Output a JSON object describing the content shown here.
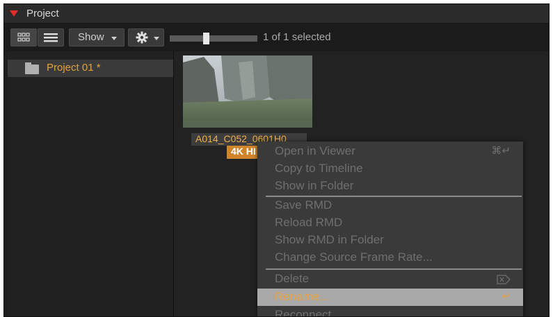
{
  "window": {
    "title": "Project"
  },
  "toolbar": {
    "grid_view_icon": "grid-view-icon",
    "list_view_icon": "list-view-icon",
    "show_label": "Show",
    "gear_icon": "gear-icon",
    "selection_status": "1 of 1 selected"
  },
  "sidebar": {
    "items": [
      {
        "label": "Project 01 *",
        "icon": "folder-icon"
      }
    ]
  },
  "clip": {
    "name": "A014_C052_0601H0",
    "resolution_badge": "4K HI"
  },
  "context_menu": {
    "items": [
      {
        "label": "Open in Viewer",
        "shortcut": "⌘↵"
      },
      {
        "label": "Copy to Timeline"
      },
      {
        "label": "Show in Folder"
      },
      {
        "label": "Save RMD"
      },
      {
        "label": "Reload RMD"
      },
      {
        "label": "Show RMD in Folder"
      },
      {
        "label": "Change Source Frame Rate..."
      },
      {
        "label": "Delete",
        "shortcut_icon": "delete-key-icon"
      },
      {
        "label": "Rename...",
        "shortcut": "↵",
        "highlighted": true
      },
      {
        "label": "Reconnect..."
      }
    ]
  },
  "colors": {
    "accent_orange": "#e2a23a",
    "badge_orange": "#d1852a",
    "titlebar_triangle": "#e32b2b",
    "menu_bg": "#3a3a3a",
    "menu_highlight": "#a9a9a9"
  }
}
